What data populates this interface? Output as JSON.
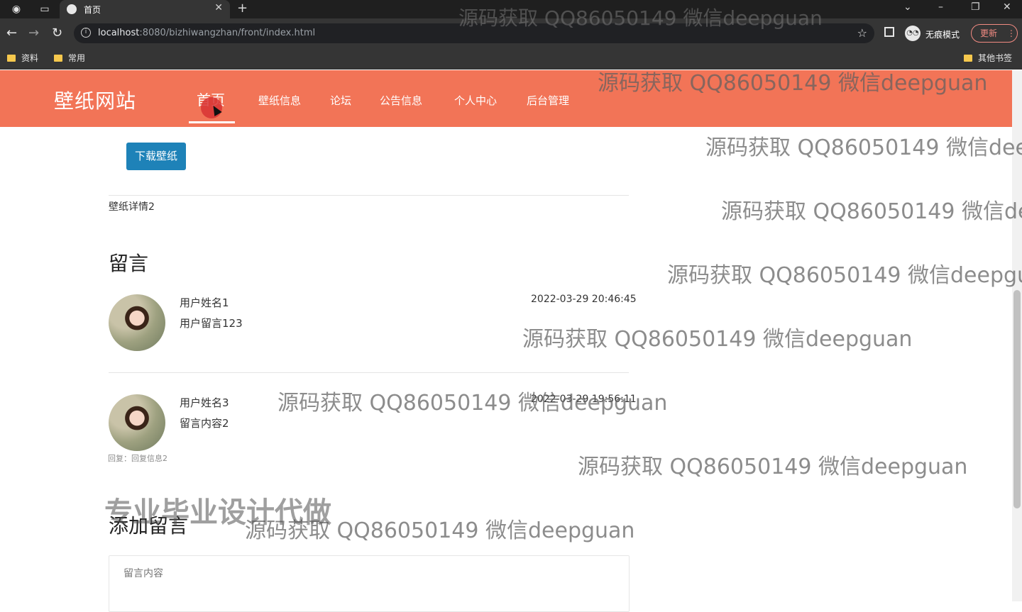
{
  "browser": {
    "tab_title": "首页",
    "url_host": "localhost",
    "url_rest": ":8080/bizhiwangzhan/front/index.html",
    "incognito_label": "无痕模式",
    "update_label": "更新",
    "bookmarks": [
      "资料",
      "常用"
    ],
    "other_bookmarks": "其他书签"
  },
  "site": {
    "logo": "壁纸网站",
    "nav": [
      "首页",
      "壁纸信息",
      "论坛",
      "公告信息",
      "个人中心",
      "后台管理"
    ]
  },
  "detail": {
    "download_label": "下载壁纸",
    "description": "壁纸详情2"
  },
  "comments": {
    "title": "留言",
    "items": [
      {
        "name": "用户姓名1",
        "text": "用户留言123",
        "time": "2022-03-29 20:46:45"
      },
      {
        "name": "用户姓名3",
        "text": "留言内容2",
        "time": "2022-03-29 19:56:11",
        "reply": "回复：回复信息2"
      }
    ]
  },
  "add_comment": {
    "title": "添加留言",
    "placeholder": "留言内容"
  },
  "watermarks": {
    "line": "源码获取 QQ86050149 微信deepguan",
    "line_cut_1": "源码获取 QQ86050149 微信dee",
    "line_cut_2": "源码获取 QQ86050149 微信de",
    "line_cut_3": "源码获取 QQ86050149 微信deepgu",
    "big": "专业毕业设计代做"
  },
  "colors": {
    "nav_bg": "#f27457",
    "button_bg": "#1e82b8"
  }
}
